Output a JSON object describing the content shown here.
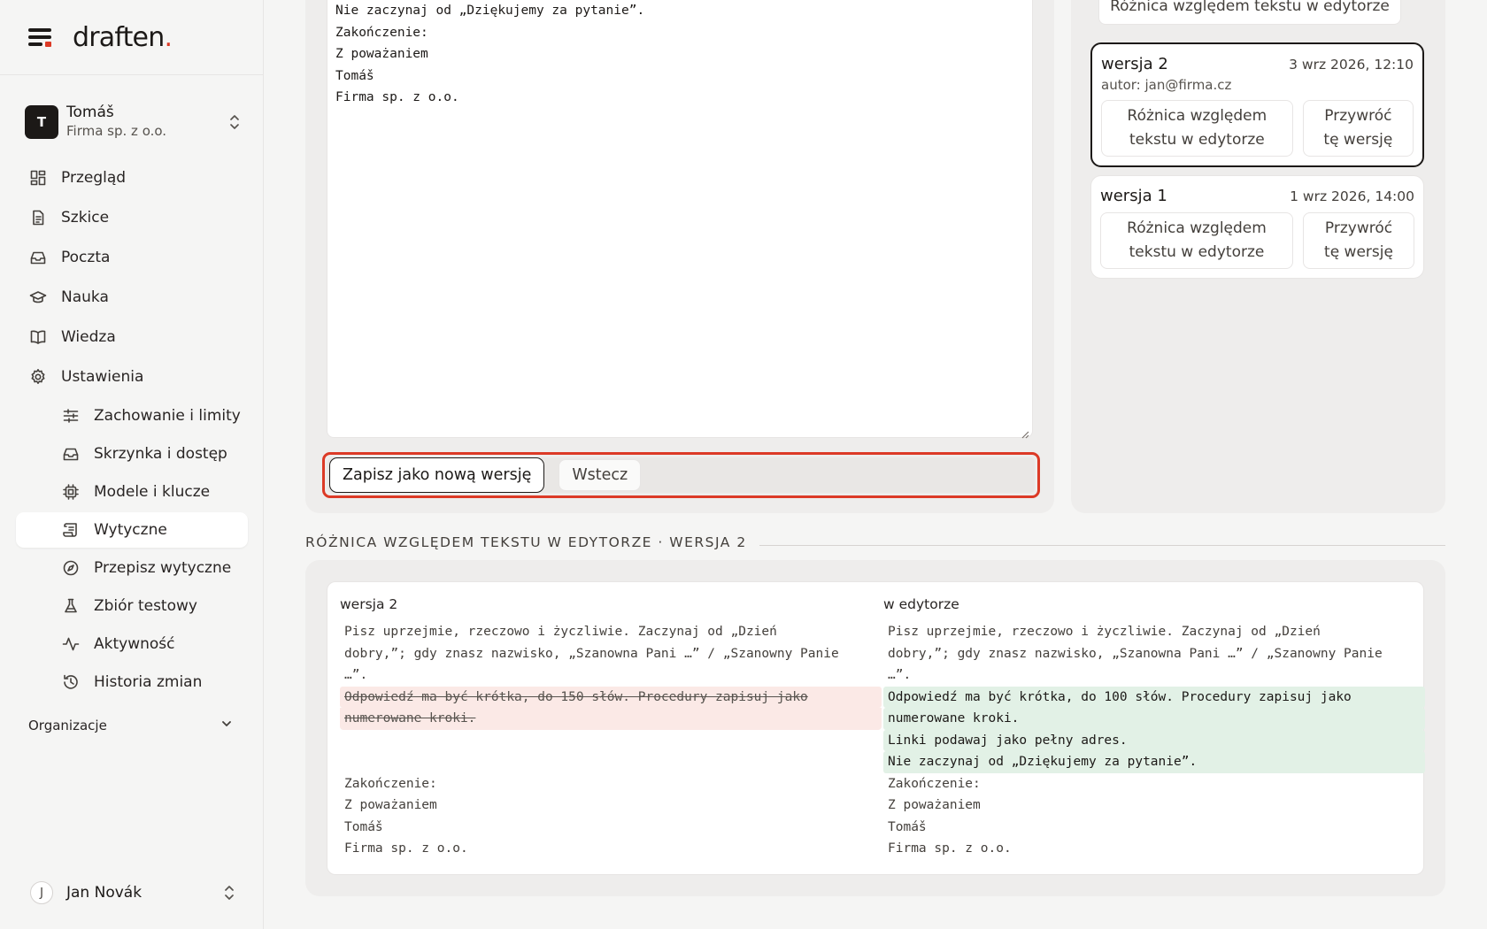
{
  "brand": {
    "name": "draften",
    "dot": "."
  },
  "account": {
    "initial": "T",
    "name": "Tomáš",
    "org": "Firma sp. z o.o."
  },
  "nav": {
    "items": [
      {
        "label": "Przegląd",
        "icon": "dashboard-icon"
      },
      {
        "label": "Szkice",
        "icon": "document-icon"
      },
      {
        "label": "Poczta",
        "icon": "inbox-icon"
      },
      {
        "label": "Nauka",
        "icon": "graduation-cap-icon"
      },
      {
        "label": "Wiedza",
        "icon": "book-icon"
      },
      {
        "label": "Ustawienia",
        "icon": "gear-icon"
      }
    ],
    "subitems": [
      {
        "label": "Zachowanie i limity",
        "icon": "sliders-icon"
      },
      {
        "label": "Skrzynka i dostęp",
        "icon": "inbox-icon"
      },
      {
        "label": "Modele i klucze",
        "icon": "cpu-chip-icon"
      },
      {
        "label": "Wytyczne",
        "icon": "scroll-icon",
        "active": true
      },
      {
        "label": "Przepisz wytyczne",
        "icon": "compass-icon"
      },
      {
        "label": "Zbiór testowy",
        "icon": "flask-icon"
      },
      {
        "label": "Aktywność",
        "icon": "activity-icon"
      },
      {
        "label": "Historia zmian",
        "icon": "history-icon"
      }
    ],
    "organizations_label": "Organizacje"
  },
  "user": {
    "initial": "J",
    "name": "Jan Novák"
  },
  "editor": {
    "lines": [
      "Nie zaczynaj od „Dziękujemy za pytanie”.",
      "Zakończenie:",
      "Z poważaniem",
      "Tomáš",
      "Firma sp. z o.o."
    ],
    "save_label": "Zapisz jako nową wersję",
    "back_label": "Wstecz"
  },
  "versions": {
    "cut_label": "Różnica względem tekstu w edytorze",
    "items": [
      {
        "title": "wersja 2",
        "date": "3 wrz 2026, 12:10",
        "author": "autor: jan@firma.cz",
        "diff_label_1": "Różnica względem",
        "diff_label_2": "tekstu w edytorze",
        "restore_label_1": "Przywróć",
        "restore_label_2": "tę wersję"
      },
      {
        "title": "wersja 1",
        "date": "1 wrz 2026, 14:00",
        "diff_label_1": "Różnica względem",
        "diff_label_2": "tekstu w edytorze",
        "restore_label_1": "Przywróć",
        "restore_label_2": "tę wersję"
      }
    ]
  },
  "diff": {
    "section_title": "RÓŻNICA WZGLĘDEM TEKSTU W EDYTORZE · WERSJA 2",
    "left_label": "wersja 2",
    "right_label": "w edytorze",
    "left": {
      "common_1": "Pisz uprzejmie, rzeczowo i życzliwie. Zaczynaj od „Dzień",
      "common_2": "dobry,”; gdy znasz nazwisko, „Szanowna Pani …” / „Szanowny Panie",
      "common_3": "…”.",
      "removed_1": "Odpowiedź ma być krótka, do 150 słów. Procedury zapisuj jako",
      "removed_2": "numerowane kroki.",
      "tail_1": "Zakończenie:",
      "tail_2": "Z poważaniem",
      "tail_3": "Tomáš",
      "tail_4": "Firma sp. z o.o."
    },
    "right": {
      "common_1": "Pisz uprzejmie, rzeczowo i życzliwie. Zaczynaj od „Dzień",
      "common_2": "dobry,”; gdy znasz nazwisko, „Szanowna Pani …” / „Szanowny Panie",
      "common_3": "…”.",
      "added_1": "Odpowiedź ma być krótka, do 100 słów. Procedury zapisuj jako",
      "added_2": "numerowane kroki.",
      "added_3": "Linki podawaj jako pełny adres.",
      "added_4": "Nie zaczynaj od „Dziękujemy za pytanie”.",
      "tail_1": "Zakończenie:",
      "tail_2": "Z poważaniem",
      "tail_3": "Tomáš",
      "tail_4": "Firma sp. z o.o."
    }
  },
  "colors": {
    "accent": "#dc3a26",
    "removed_bg": "#fbe9e6",
    "added_bg": "#e2f1e6"
  }
}
